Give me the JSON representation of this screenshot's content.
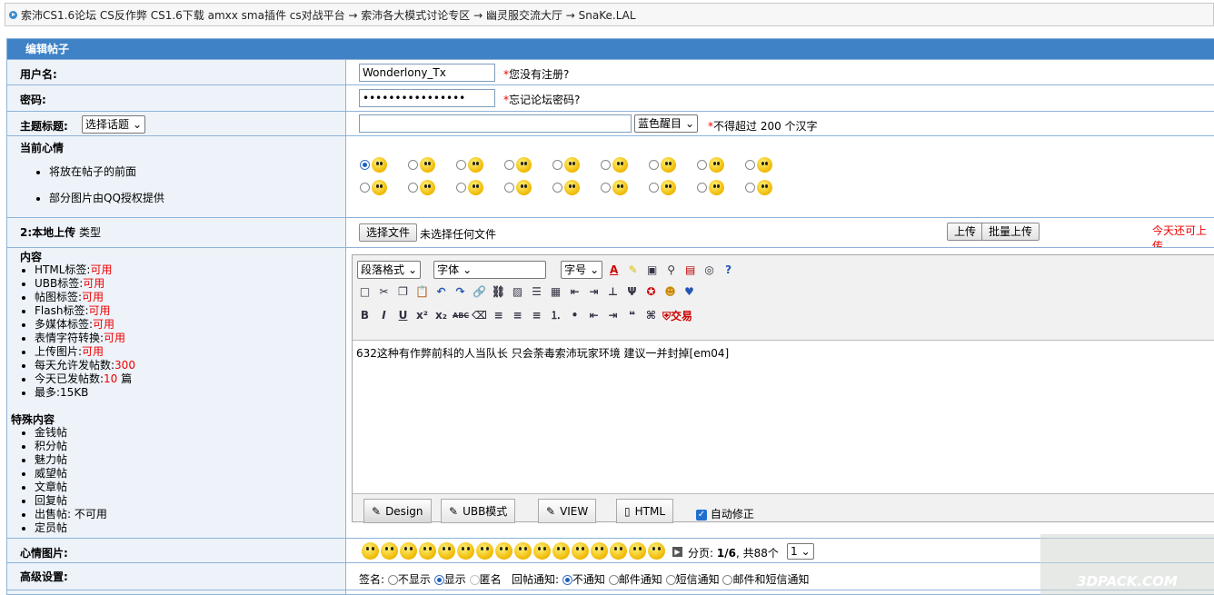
{
  "breadcrumb": "索沛CS1.6论坛 CS反作弊 CS1.6下载 amxx sma插件 cs对战平台 → 索沛各大模式讨论专区 → 幽灵服交流大厅 → SnaKe.LAL",
  "header": "编辑帖子",
  "username": {
    "label": "用户名:",
    "value": "Wonderlony_Tx",
    "asterisk": "*",
    "hint": "您没有注册?"
  },
  "password": {
    "label": "密码:",
    "value": "••••••••••••••••",
    "asterisk": "*",
    "hint": "忘记论坛密码?"
  },
  "subject": {
    "label": "主题标题:",
    "topic_select": "选择话题",
    "value": "",
    "color_select": "蓝色醒目",
    "asterisk": "*",
    "hint": "不得超过 200 个汉字"
  },
  "mood": {
    "title": "当前心情",
    "bullets": [
      "将放在帖子的前面",
      "部分图片由QQ授权提供"
    ],
    "selected_index": 0,
    "count": 18
  },
  "upload": {
    "label": "2:本地上传",
    "label_suffix": "类型",
    "choose": "选择文件",
    "no_file": "未选择任何文件",
    "upload_btn": "上传",
    "batch_btn": "批量上传",
    "notice": "今天还可上传"
  },
  "content": {
    "title": "内容",
    "items": [
      {
        "k": "HTML标签:",
        "v": "可用"
      },
      {
        "k": "UBB标签:",
        "v": "可用"
      },
      {
        "k": "帖图标签:",
        "v": "可用"
      },
      {
        "k": "Flash标签:",
        "v": "可用"
      },
      {
        "k": "多媒体标签:",
        "v": "可用"
      },
      {
        "k": "表情字符转换:",
        "v": "可用"
      },
      {
        "k": "上传图片:",
        "v": "可用"
      },
      {
        "k": "每天允许发帖数:",
        "v": "300"
      },
      {
        "k": "今天已发帖数:",
        "v": "10",
        "s": "篇"
      },
      {
        "k": "最多:",
        "v": "15KB"
      }
    ],
    "special_title": "特殊内容",
    "special": [
      "金钱帖",
      "积分帖",
      "魅力帖",
      "威望帖",
      "文章帖",
      "回复帖",
      "出售帖: 不可用",
      "定员帖"
    ]
  },
  "editor": {
    "format_select": "段落格式",
    "font_select": "字体",
    "size_select": "字号",
    "text": "632这种有作弊前科的人当队长 只会荼毒索沛玩家环境 建议一并封掉[em04]",
    "trade_label": "交易",
    "tabs": [
      "Design",
      "UBB模式",
      "VIEW",
      "HTML"
    ],
    "autofix": "自动修正"
  },
  "emotion": {
    "label": "心情图片:",
    "page_text": "分页: ",
    "page": "1/6",
    "total_text": ", 共88个",
    "page_select": "1"
  },
  "advanced": {
    "label": "高级设置:",
    "sign_label": "签名:",
    "sign_opts": [
      "不显示",
      "显示",
      "匿名"
    ],
    "notify_label": "回帖通知:",
    "notify_opts": [
      "不通知",
      "邮件通知",
      "短信通知",
      "邮件和短信通知"
    ]
  },
  "watermark": "3DPACK.COM",
  "colors": {
    "header": "#3f82c6",
    "border": "#8eb3d9",
    "label_bg": "#eef3f9",
    "red": "#ee0000"
  }
}
